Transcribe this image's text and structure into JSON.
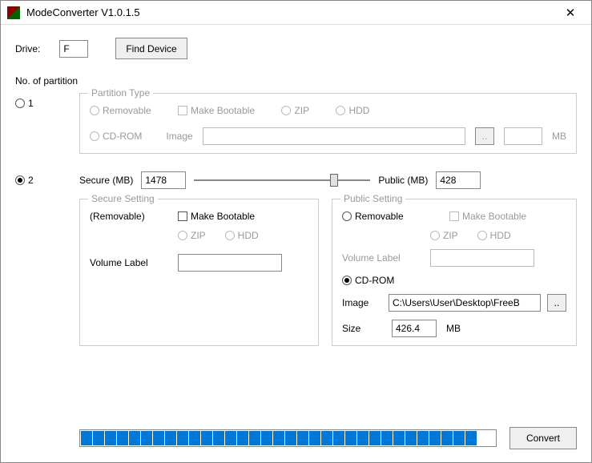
{
  "window": {
    "title": "ModeConverter V1.0.1.5"
  },
  "drive": {
    "label": "Drive:",
    "value": "F",
    "findDevice": "Find Device"
  },
  "partition": {
    "sectionLabel": "No. of partition",
    "option1": "1",
    "option2": "2",
    "selected": 2
  },
  "partitionType": {
    "title": "Partition Type",
    "removable": "Removable",
    "makeBootable": "Make Bootable",
    "zip": "ZIP",
    "hdd": "HDD",
    "cdrom": "CD-ROM",
    "image": "Image",
    "browse": "..",
    "mb": "MB"
  },
  "sizes": {
    "secureLabel": "Secure (MB)",
    "secureValue": "1478",
    "publicLabel": "Public (MB)",
    "publicValue": "428"
  },
  "secureSetting": {
    "title": "Secure Setting",
    "removableNote": "(Removable)",
    "makeBootable": "Make Bootable",
    "zip": "ZIP",
    "hdd": "HDD",
    "volumeLabel": "Volume Label",
    "volumeValue": ""
  },
  "publicSetting": {
    "title": "Public Setting",
    "removable": "Removable",
    "makeBootable": "Make Bootable",
    "zip": "ZIP",
    "hdd": "HDD",
    "volumeLabel": "Volume Label",
    "volumeValue": "",
    "cdrom": "CD-ROM",
    "image": "Image",
    "imagePath": "C:\\Users\\User\\Desktop\\FreeB",
    "browse": "..",
    "sizeLabel": "Size",
    "sizeValue": "426.4",
    "mb": "MB"
  },
  "convert": "Convert"
}
